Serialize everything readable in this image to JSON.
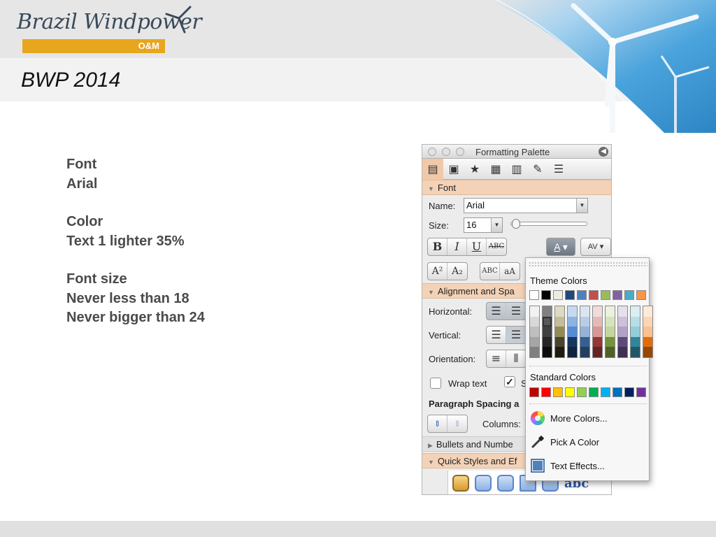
{
  "header": {
    "logo_text": "Brazil Windpower",
    "logo_subtext": "O&M",
    "slide_title": "BWP 2014"
  },
  "body": {
    "lines": [
      "Font",
      "Arial",
      "",
      "Color",
      "Text 1 lighter 35%",
      "",
      "Font size",
      "Never less than 18",
      "Never bigger than 24"
    ]
  },
  "palette": {
    "title": "Formatting Palette",
    "tab_icons": [
      "text-box-icon",
      "object-palette-icon",
      "toolbox-star-icon",
      "scrapbook-icon",
      "reference-tools-icon",
      "compatibility-wrench-icon",
      "project-palette-icon"
    ],
    "font_section": {
      "header": "Font",
      "name_label": "Name:",
      "name_value": "Arial",
      "size_label": "Size:",
      "size_value": "16",
      "style_buttons": [
        "B",
        "I",
        "U",
        "ABC"
      ],
      "font_color_glyph": "A",
      "spacing_glyph": "AV",
      "super_glyph": "A²",
      "sub_glyph": "A₂",
      "smallcaps_glyph": "ABC",
      "case_glyph": "aA"
    },
    "alignment_section": {
      "header": "Alignment and Spa",
      "horizontal_label": "Horizontal:",
      "vertical_label": "Vertical:",
      "orientation_label": "Orientation:",
      "wrap_text_label": "Wrap text",
      "second_checkbox_label": "S",
      "paragraph_spacing_label": "Paragraph Spacing a",
      "columns_label": "Columns:"
    },
    "bullets_section": {
      "header": "Bullets and Numbe"
    },
    "quick_styles_section": {
      "header": "Quick Styles and Ef",
      "sample_text": "abc"
    }
  },
  "color_menu": {
    "theme_label": "Theme Colors",
    "theme_colors": [
      "#ffffff",
      "#000000",
      "#eeece1",
      "#1f497d",
      "#4f81bd",
      "#c0504d",
      "#9bbb59",
      "#8064a2",
      "#4bacc6",
      "#f79646"
    ],
    "theme_shades": [
      [
        "#f2f2f2",
        "#d9d9d9",
        "#bfbfbf",
        "#a6a6a6",
        "#808080"
      ],
      [
        "#808080",
        "#595959",
        "#404040",
        "#262626",
        "#0d0d0d"
      ],
      [
        "#ddd9c3",
        "#c4bd97",
        "#948a54",
        "#4a452a",
        "#1e1c11"
      ],
      [
        "#c6d9f0",
        "#8db3e2",
        "#548dd4",
        "#17365d",
        "#0f243e"
      ],
      [
        "#dbe5f1",
        "#b8cce4",
        "#95b3d7",
        "#366092",
        "#244061"
      ],
      [
        "#f2dcdb",
        "#e5b9b7",
        "#d99694",
        "#953734",
        "#632423"
      ],
      [
        "#ebf1dd",
        "#d7e3bc",
        "#c3d69b",
        "#76923c",
        "#4f6128"
      ],
      [
        "#e5e0ec",
        "#ccc1d9",
        "#b2a2c7",
        "#5f497a",
        "#3f3151"
      ],
      [
        "#dbeef3",
        "#b7dde8",
        "#92cddc",
        "#31859b",
        "#205867"
      ],
      [
        "#fdeada",
        "#fbd5b5",
        "#fac08f",
        "#e36c09",
        "#974806"
      ]
    ],
    "selected_shade": "Text 1 lighter 35%",
    "standard_label": "Standard Colors",
    "standard_colors": [
      "#c00000",
      "#ff0000",
      "#ffc000",
      "#ffff00",
      "#92d050",
      "#00b050",
      "#00b0f0",
      "#0070c0",
      "#002060",
      "#7030a0"
    ],
    "items": [
      {
        "label": "More Colors...",
        "icon": "color-wheel-icon"
      },
      {
        "label": "Pick A Color",
        "icon": "eyedropper-icon"
      },
      {
        "label": "Text Effects...",
        "icon": "text-effects-icon"
      }
    ]
  },
  "colors": {
    "accent_orange": "#e7a61e",
    "section_header": "#f3d2b7",
    "body_text": "#4a4a4a"
  }
}
